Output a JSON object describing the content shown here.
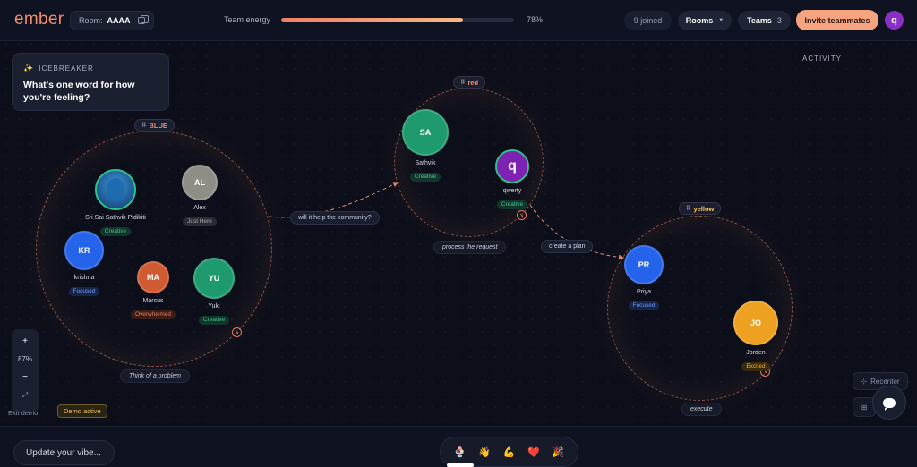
{
  "app": {
    "logo": "ember"
  },
  "header": {
    "room_label": "Room:",
    "room_code": "AAAA",
    "energy_label": "Team energy",
    "energy_value": 78,
    "energy_pct": "78%",
    "joined": "9 joined",
    "rooms_label": "Rooms",
    "teams_label": "Teams",
    "teams_count": "3",
    "invite_label": "Invite teammates",
    "user_initial": "q"
  },
  "icebreaker": {
    "heading": "ICEBREAKER",
    "question": "What's one word for how you're feeling?"
  },
  "activity_label": "ACTIVITY",
  "colors": {
    "accent": "#f6a37f",
    "blue_team": "#f08a6e",
    "red_team": "#f08a6e",
    "yellow_team": "#f6c35a"
  },
  "teams": [
    {
      "tag": "BLUE",
      "caption": "Think of a problem"
    },
    {
      "tag": "red",
      "caption": "process the request"
    },
    {
      "tag": "yellow",
      "caption": "execute"
    }
  ],
  "members": [
    {
      "name": "Sri Sai Sathvik Pidikiti",
      "initials": "",
      "mood": "Creative",
      "color": "#1f8a66"
    },
    {
      "name": "Alex",
      "initials": "AL",
      "mood": "Just Here",
      "color": "#8e8e86"
    },
    {
      "name": "krishna",
      "initials": "KR",
      "mood": "Focused",
      "color": "#2563eb"
    },
    {
      "name": "Marcus",
      "initials": "MA",
      "mood": "Overwhelmed",
      "color": "#d05a32"
    },
    {
      "name": "Yuki",
      "initials": "YU",
      "mood": "Creative",
      "color": "#1f9a6e"
    },
    {
      "name": "Sathvik",
      "initials": "SA",
      "mood": "Creative",
      "color": "#1f9a6e"
    },
    {
      "name": "qwerty",
      "initials": "q",
      "mood": "Creative",
      "color": "#7d22b3"
    },
    {
      "name": "Priya",
      "initials": "PR",
      "mood": "Focused",
      "color": "#2563eb"
    },
    {
      "name": "Jorden",
      "initials": "JO",
      "mood": "Excited",
      "color": "#eea020"
    }
  ],
  "edges": [
    {
      "label": "will it help the community?"
    },
    {
      "label": "create a plan"
    }
  ],
  "zoom": {
    "plus": "+",
    "minus": "−",
    "level": "87%"
  },
  "controls": {
    "exit_demo": "Exit demo",
    "demo_active": "Demo active",
    "recenter": "Recenter"
  },
  "bottom": {
    "vibe_placeholder": "Update your vibe...",
    "reactions": [
      "🍨",
      "👋",
      "💪",
      "❤️",
      "🎉"
    ]
  }
}
